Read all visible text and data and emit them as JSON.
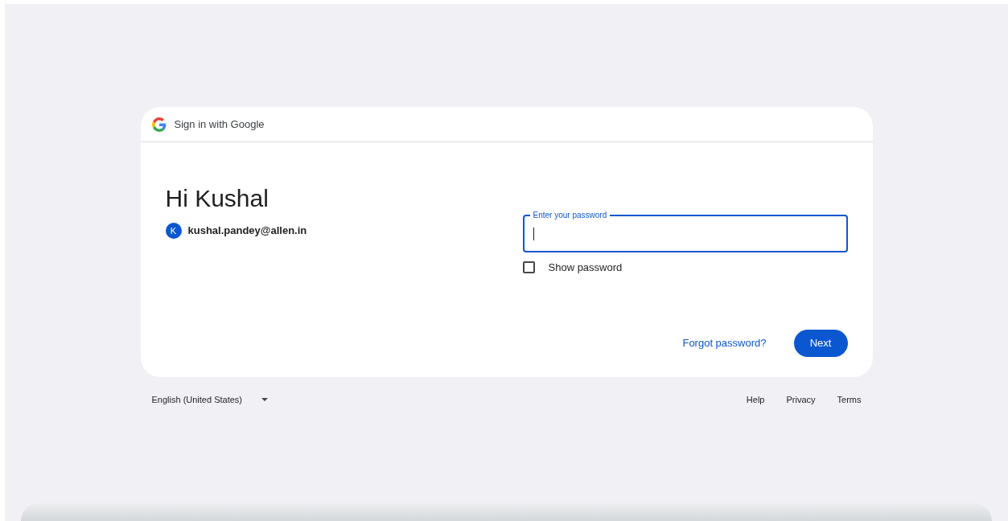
{
  "header": {
    "title": "Sign in with Google"
  },
  "greeting": "Hi Kushal",
  "account": {
    "initial": "K",
    "email": "kushal.pandey@allen.in"
  },
  "password_field": {
    "label": "Enter your password",
    "focused": true
  },
  "show_password": {
    "label": "Show password",
    "checked": false
  },
  "forgot_link": "Forgot password?",
  "next_button": "Next",
  "footer": {
    "language": "English (United States)",
    "links": [
      "Help",
      "Privacy",
      "Terms"
    ]
  }
}
